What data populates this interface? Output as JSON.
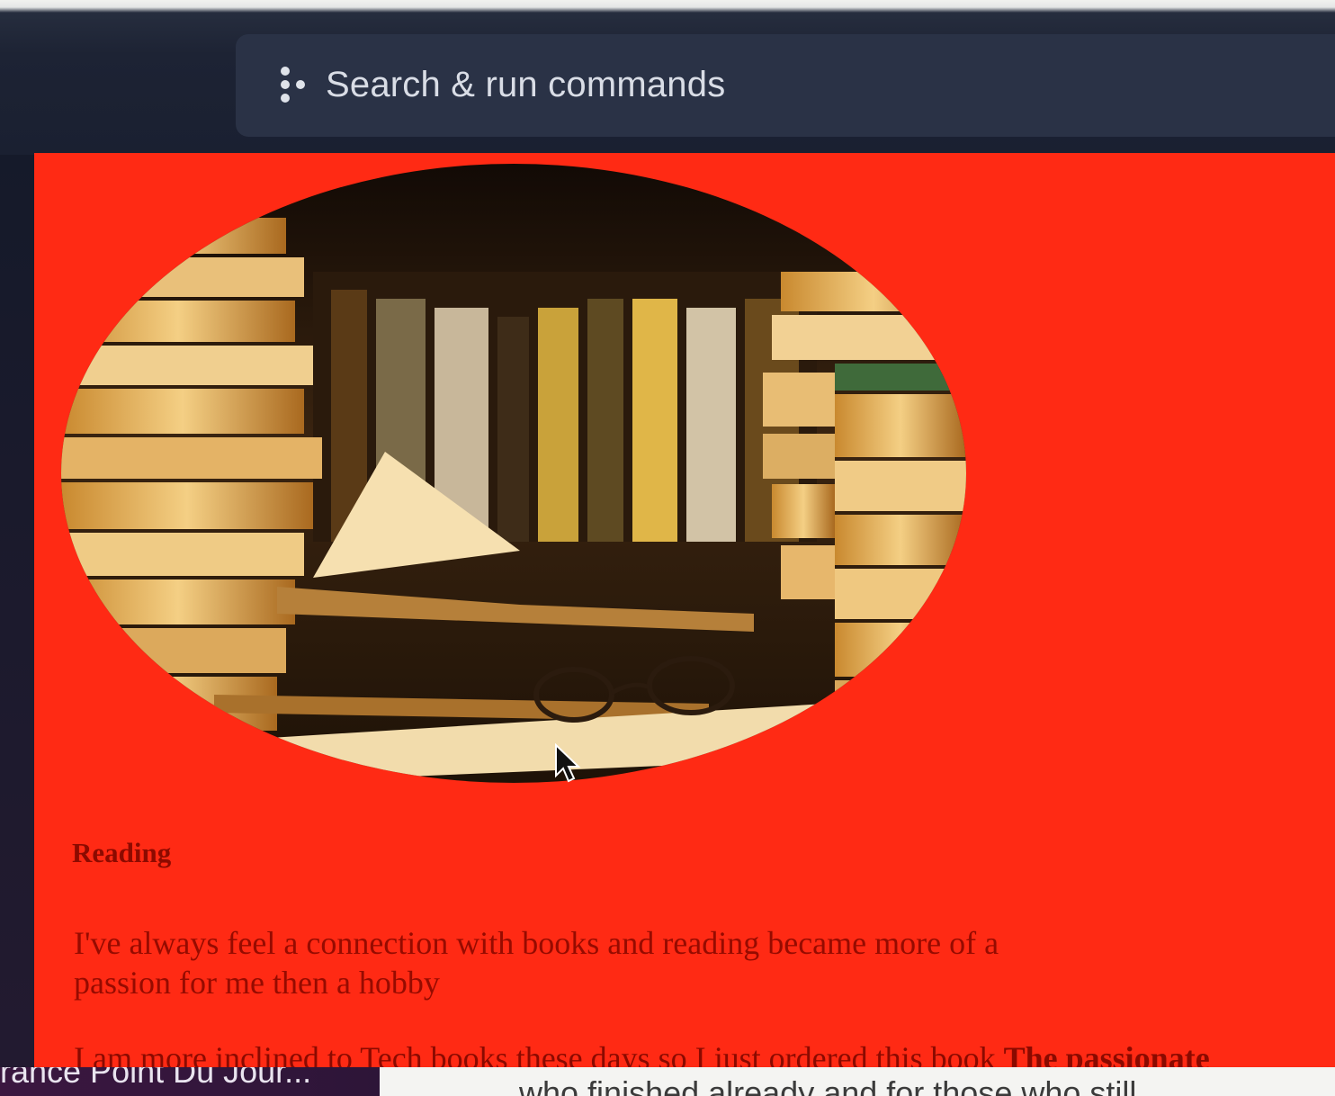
{
  "search": {
    "placeholder": "Search & run commands",
    "icon": "command-dots-icon"
  },
  "colors": {
    "page_background": "#ff2a14",
    "topbar": "#1d2334",
    "search_box": "#2a3246",
    "text": "#8c0a00"
  },
  "content": {
    "image": "books-and-glasses-photo",
    "heading": "Reading",
    "paragraph1": "I've always feel a connection with books and reading became more of a passion for me then a hobby",
    "paragraph2_start": "I am more inclined to Tech books these days so I just ordered this book ",
    "paragraph2_bold": "The passionate"
  },
  "taskbar": {
    "left_tab_title": "rance Point Du Jour...",
    "right_panel_text": "who finished already and for those who still"
  }
}
